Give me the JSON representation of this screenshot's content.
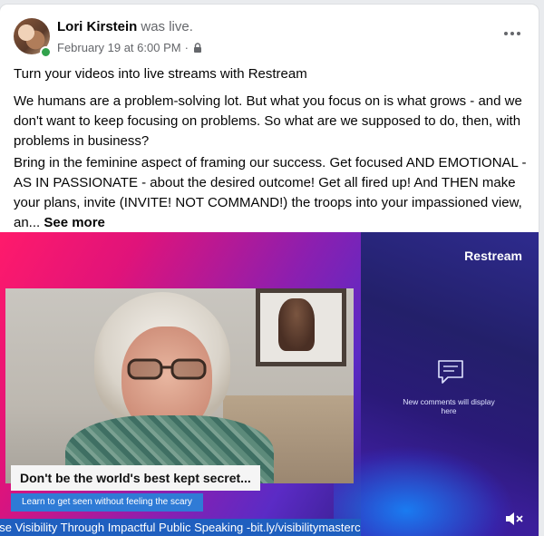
{
  "post": {
    "author_name": "Lori Kirstein",
    "author_status": "was live.",
    "date": "February 19 at 6:00 PM",
    "separator": "·",
    "privacy_icon": "lock-icon",
    "more_icon": "more-options-icon",
    "paragraphs": [
      "Turn your videos into live streams with Restream",
      "We humans are a problem-solving lot. But what you focus on is what grows - and we don't want to keep focusing on problems. So what are we supposed to do, then, with problems in business?",
      "Bring in the feminine aspect of framing our success. Get focused AND EMOTIONAL - AS IN PASSIONATE - about the desired outcome! Get all fired up! And THEN make your plans, invite (INVITE! NOT COMMAND!) the troops into your impassioned view, an..."
    ],
    "see_more_label": "See more"
  },
  "video": {
    "brand": "Restream",
    "comment_icon": "speech-bubble-icon",
    "comments_placeholder": "New comments will display here",
    "banner_title": "Don't be the world's best kept secret...",
    "banner_subtitle": "Learn to get seen without feeling the scary",
    "ticker_text": "ase Visibility Through Impactful Public Speaking -bit.ly/visibilitymasterclass",
    "mute_icon": "speaker-muted-icon"
  },
  "colors": {
    "accent_blue": "#1f5fbf",
    "online_green": "#31a24c",
    "video_magenta": "#e0137a"
  }
}
